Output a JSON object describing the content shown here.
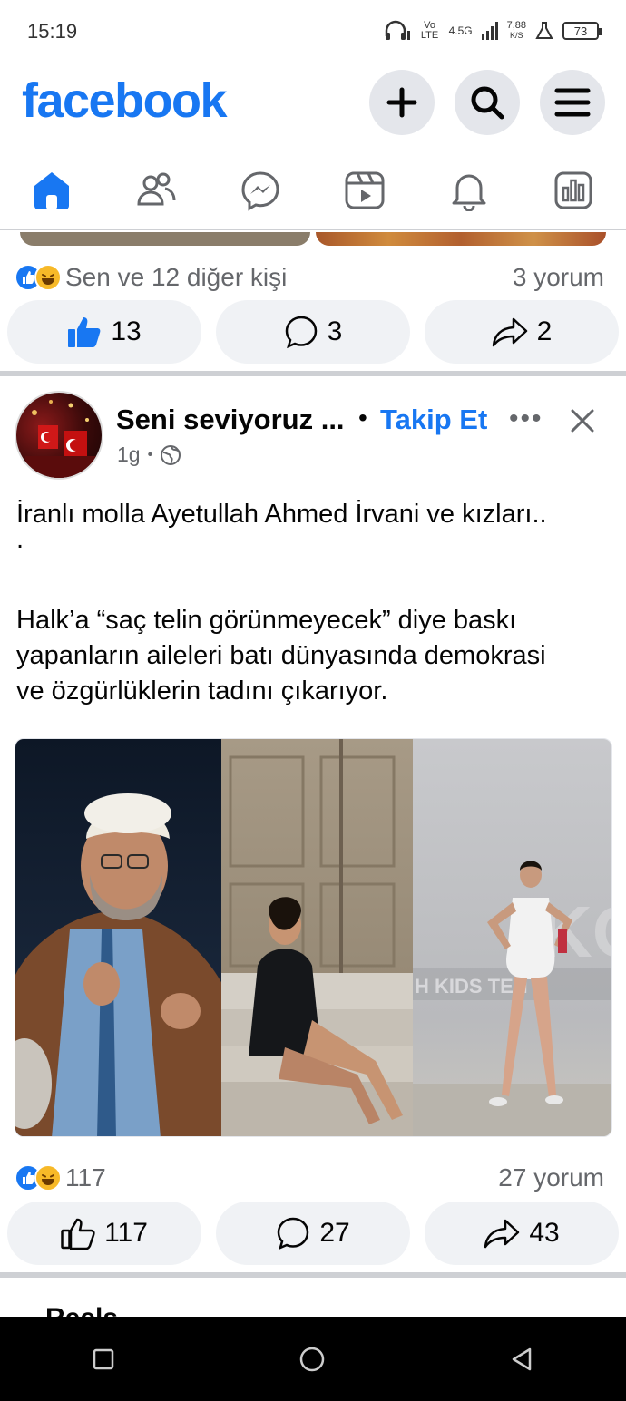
{
  "status_bar": {
    "time": "15:19",
    "network_label": "Vo LTE",
    "signal_label": "4.5G",
    "speed_value": "7,88",
    "speed_unit": "K/S",
    "battery": "73"
  },
  "header": {
    "logo": "facebook",
    "colors": {
      "brand": "#1877f2",
      "button_bg": "#e4e6eb"
    },
    "buttons": [
      "plus-icon",
      "search-icon",
      "menu-icon"
    ]
  },
  "nav": {
    "tabs": [
      {
        "id": "home",
        "icon": "home-icon",
        "active": true
      },
      {
        "id": "friends",
        "icon": "friends-icon",
        "active": false
      },
      {
        "id": "messenger",
        "icon": "messenger-icon",
        "active": false
      },
      {
        "id": "video",
        "icon": "video-icon",
        "active": false
      },
      {
        "id": "notifications",
        "icon": "bell-icon",
        "active": false
      },
      {
        "id": "dashboard",
        "icon": "dashboard-icon",
        "active": false
      }
    ]
  },
  "prev_post": {
    "reactions_text": "Sen ve 12 diğer kişi",
    "comments_text": "3 yorum",
    "like_count": "13",
    "comment_count": "3",
    "share_count": "2"
  },
  "post": {
    "page_name": "Seni seviyoruz ...",
    "separator": "•",
    "follow_label": "Takip Et",
    "more_label": "•••",
    "time": "1g",
    "meta_dot": "•",
    "text_lines": [
      "İranlı molla Ayetullah Ahmed İrvani ve kızları..",
      ".",
      "",
      "Halk’a “saç telin görünmeyecek” diye baskı",
      "yapanların aileleri batı dünyasında demokrasi",
      "ve özgürlüklerin tadını çıkarıyor."
    ],
    "image_watermark": "H KIDS   TEH",
    "reaction_count": "117",
    "comments_text": "27 yorum",
    "like_count": "117",
    "comment_count": "27",
    "share_count": "43"
  },
  "next_section": {
    "title": "Reels"
  }
}
